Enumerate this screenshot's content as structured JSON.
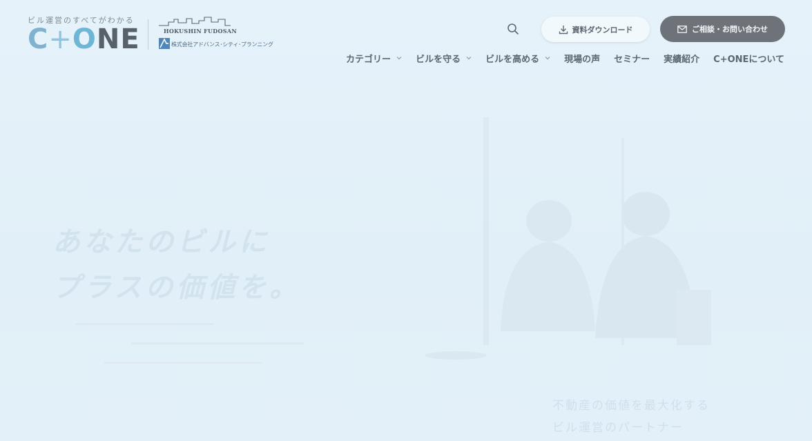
{
  "logo": {
    "tagline": "ビル運営のすべてがわかる",
    "mark_c": "C",
    "mark_plus": "+",
    "mark_o": "O",
    "mark_ne": "NE"
  },
  "partner": {
    "name": "HOKUSHIN FUDOSAN",
    "sub": "株式会社アドバンス･シティ･プランニング"
  },
  "header": {
    "download_label": "資料ダウンロード",
    "contact_label": "ご相談・お問い合わせ"
  },
  "nav": {
    "items": [
      {
        "label": "カテゴリー",
        "dropdown": true
      },
      {
        "label": "ビルを守る",
        "dropdown": true
      },
      {
        "label": "ビルを高める",
        "dropdown": true
      },
      {
        "label": "現場の声",
        "dropdown": false
      },
      {
        "label": "セミナー",
        "dropdown": false
      },
      {
        "label": "実績紹介",
        "dropdown": false
      },
      {
        "label": "C+ONEについて",
        "dropdown": false
      }
    ]
  },
  "hero": {
    "title_line1": "あなたのビルに",
    "title_line2": "プラスの価値を。",
    "sub_line1": "不動産の価値を最大化する",
    "sub_line2": "ビル運営のパートナー"
  },
  "colors": {
    "background": "#e4f1f9",
    "contact_button": "#6e7379",
    "brand_blue": "#6fb5d6",
    "brand_dark": "#58606a"
  },
  "icons": {
    "search": "search-icon",
    "download": "download-icon",
    "mail": "mail-icon",
    "chevron": "chevron-down-icon"
  }
}
